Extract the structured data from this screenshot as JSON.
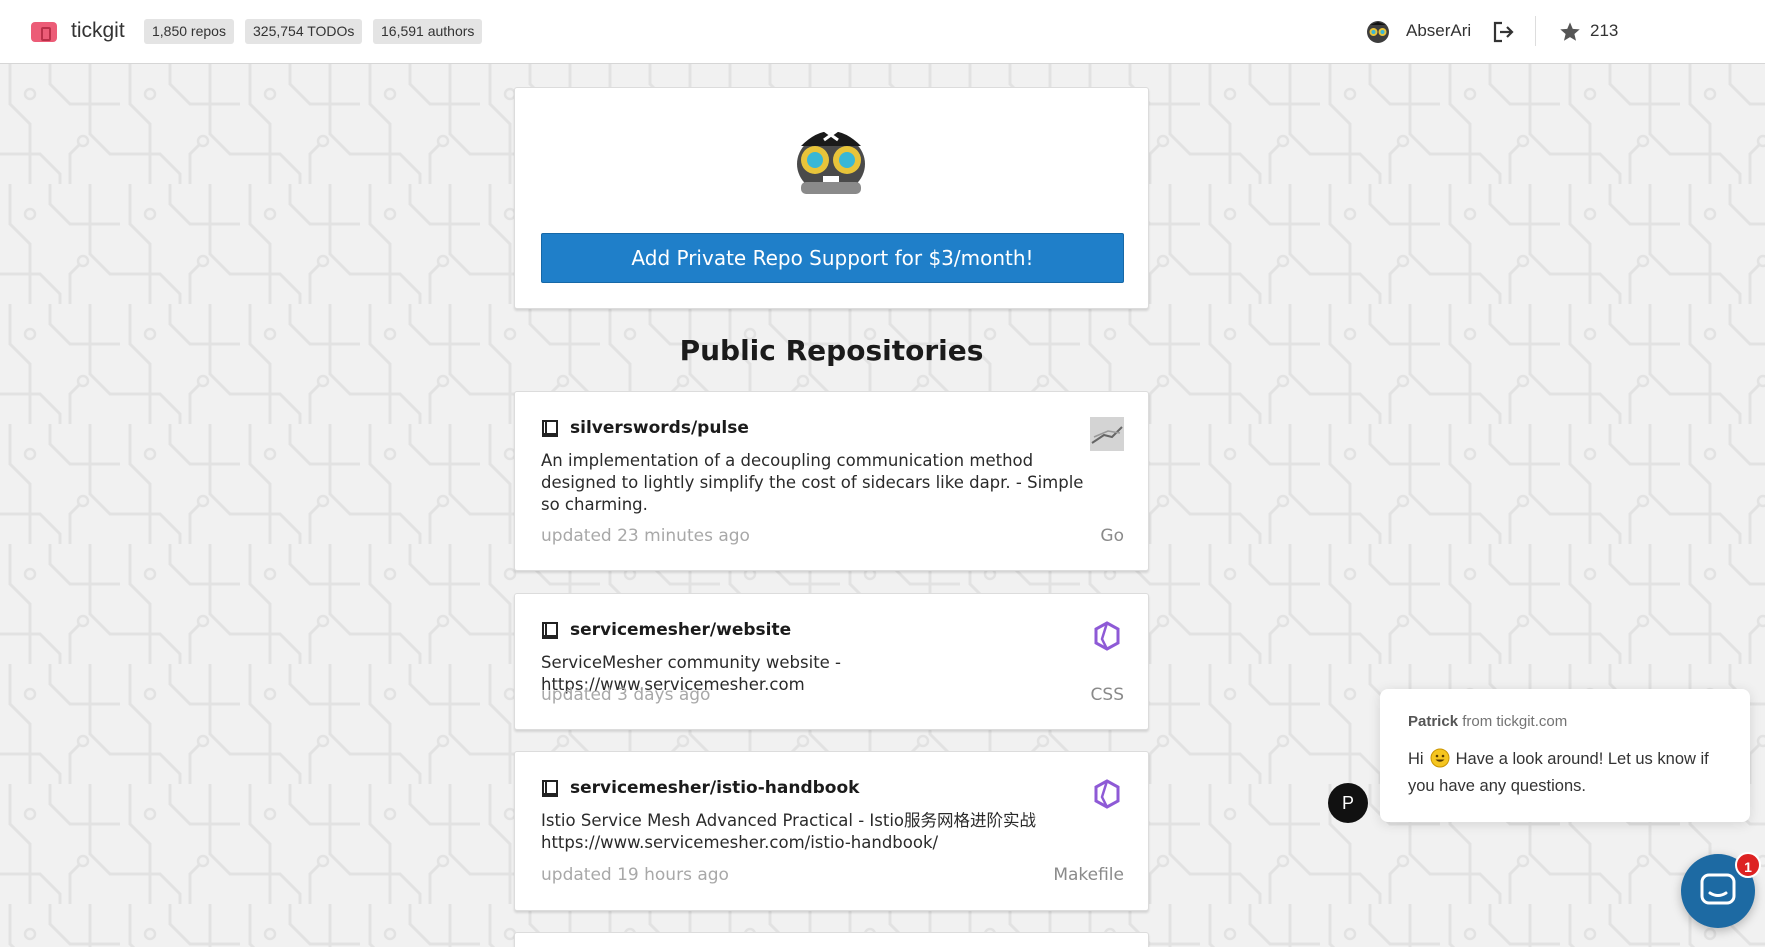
{
  "navbar": {
    "brand": "tickgit",
    "stats": [
      "1,850 repos",
      "325,754 TODOs",
      "16,591 authors"
    ],
    "username": "AbserAri",
    "star_count": "213"
  },
  "promo": {
    "cta_label": "Add Private Repo Support for $3/month!"
  },
  "section_title": "Public Repositories",
  "repos": [
    {
      "name": "silverswords/pulse",
      "description": "An implementation of a decoupling communication method designed to lightly simplify the cost of sidecars like dapr. - Simple so charming.",
      "updated": "updated 23 minutes ago",
      "language": "Go"
    },
    {
      "name": "servicemesher/website",
      "description": "ServiceMesher community website - https://www.servicemesher.com",
      "updated": "updated 3 days ago",
      "language": "CSS"
    },
    {
      "name": "servicemesher/istio-handbook",
      "description_line1": "Istio Service Mesh Advanced Practical - Istio服务网格进阶实战",
      "description_line2": "https://www.servicemesher.com/istio-handbook/",
      "updated": "updated 19 hours ago",
      "language": "Makefile"
    }
  ],
  "chat": {
    "sender_name": "Patrick",
    "sender_from": "from tickgit.com",
    "greeting": "Hi",
    "message_rest": "Have a look around! Let us know if you have any questions.",
    "avatar_initial": "P",
    "unread_count": "1"
  },
  "colors": {
    "accent": "#1f7fc9",
    "brand": "#ec5c77",
    "repo_org_icon": "#8e5ad6"
  }
}
